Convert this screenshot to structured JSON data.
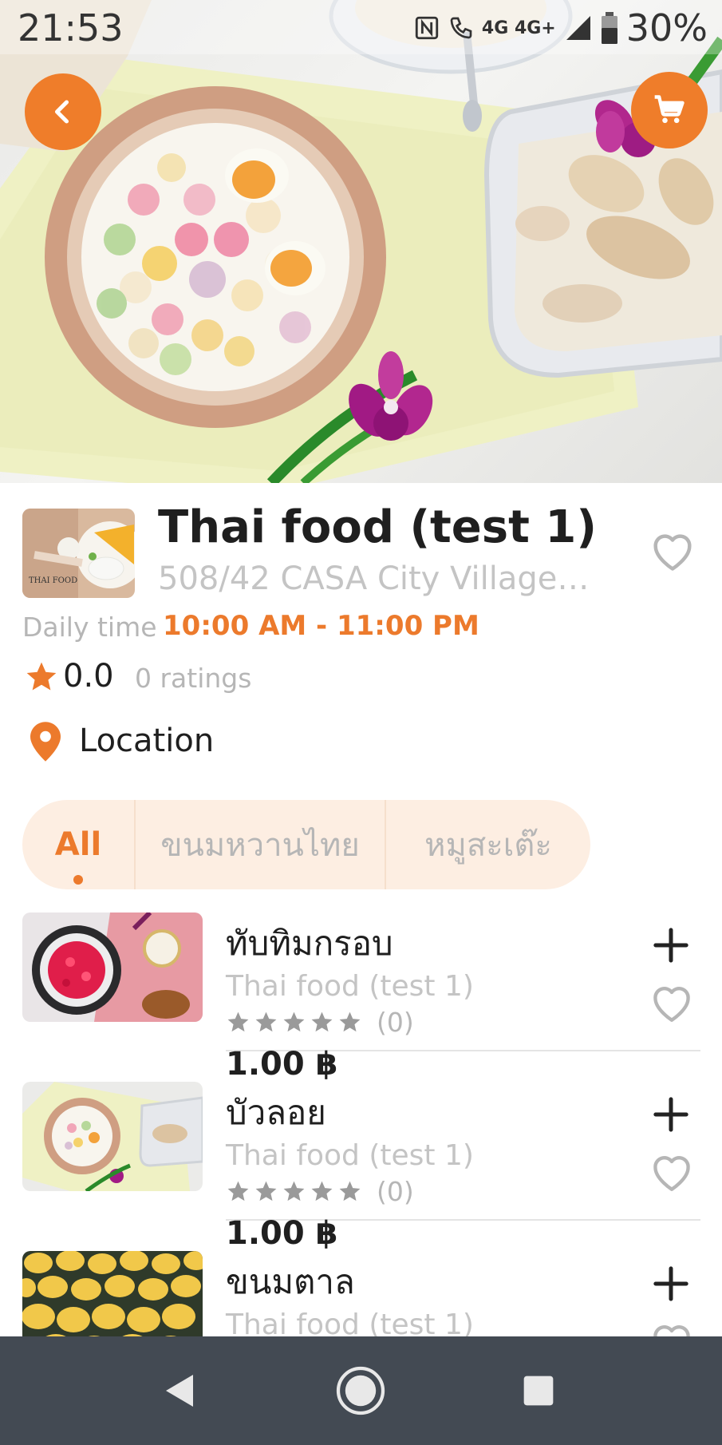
{
  "status_bar": {
    "time": "21:53",
    "network": "4G 4G+",
    "battery": "30%"
  },
  "hero": {
    "back_icon": "chevron-left-icon",
    "cart_icon": "shopping-cart-icon"
  },
  "restaurant": {
    "name": "Thai food (test 1)",
    "address": "508/42 CASA City Village, ...",
    "logo_text": "THAI FOOD",
    "daily_label": "Daily time",
    "daily_time": "10:00 AM - 11:00 PM",
    "rating_value": "0.0",
    "rating_count": "0 ratings",
    "location_label": "Location"
  },
  "tabs": [
    {
      "label": "All"
    },
    {
      "label": "ขนมหวานไทย"
    },
    {
      "label": "หมูสะเต๊ะ"
    }
  ],
  "products": [
    {
      "name": "ทับทิมกรอบ",
      "shop": "Thai food (test 1)",
      "rating_count": "(0)",
      "price": "1.00 ฿"
    },
    {
      "name": "บัวลอย",
      "shop": "Thai food (test 1)",
      "rating_count": "(0)",
      "price": "1.00 ฿"
    },
    {
      "name": "ขนมตาล",
      "shop": "Thai food (test 1)",
      "rating_count": "",
      "price": ""
    }
  ],
  "colors": {
    "accent": "#ec7a2c",
    "tab_bg": "#fdeee2",
    "navbar": "#434a53"
  }
}
